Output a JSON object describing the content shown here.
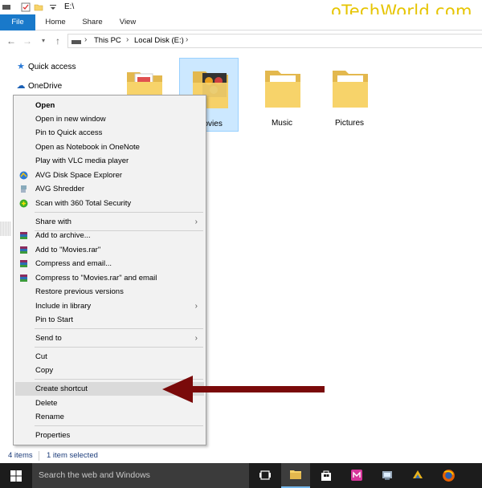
{
  "titlebar": {
    "path": "E:\\",
    "watermark": "oTechWorld.com"
  },
  "ribbon": {
    "tabs": [
      "File",
      "Home",
      "Share",
      "View"
    ]
  },
  "address": {
    "crumbs": [
      "This PC",
      "Local Disk (E:)"
    ]
  },
  "navpane": {
    "items": [
      {
        "label": "Quick access",
        "icon": "star-icon"
      },
      {
        "label": "OneDrive",
        "icon": "cloud-icon"
      }
    ]
  },
  "folders": [
    {
      "label": "",
      "icon": "document-folder-icon",
      "selected": false
    },
    {
      "label": "Movies",
      "icon": "movie-folder-icon",
      "selected": true
    },
    {
      "label": "Music",
      "icon": "folder-icon",
      "selected": false
    },
    {
      "label": "Pictures",
      "icon": "folder-icon",
      "selected": false
    }
  ],
  "context_menu": {
    "items": [
      {
        "label": "Open",
        "bold": true
      },
      {
        "label": "Open in new window"
      },
      {
        "label": "Pin to Quick access"
      },
      {
        "label": "Open as Notebook in OneNote"
      },
      {
        "label": "Play with VLC media player"
      },
      {
        "label": "AVG Disk Space Explorer",
        "icon": "avg-icon"
      },
      {
        "label": "AVG Shredder",
        "icon": "shredder-icon"
      },
      {
        "label": "Scan with 360 Total Security",
        "icon": "security-360-icon"
      },
      {
        "label": "Share with",
        "submenu": true
      },
      {
        "label": "Add to archive...",
        "icon": "winrar-icon"
      },
      {
        "label": "Add to \"Movies.rar\"",
        "icon": "winrar-icon"
      },
      {
        "label": "Compress and email...",
        "icon": "winrar-icon"
      },
      {
        "label": "Compress to \"Movies.rar\" and email",
        "icon": "winrar-icon"
      },
      {
        "label": "Restore previous versions"
      },
      {
        "label": "Include in library",
        "submenu": true
      },
      {
        "label": "Pin to Start"
      },
      {
        "label": "Send to",
        "submenu": true
      },
      {
        "label": "Cut"
      },
      {
        "label": "Copy"
      },
      {
        "label": "Create shortcut",
        "highlighted": true
      },
      {
        "label": "Delete"
      },
      {
        "label": "Rename"
      },
      {
        "label": "Properties"
      }
    ]
  },
  "status": {
    "items_count": "4 items",
    "selected": "1 item selected"
  },
  "taskbar": {
    "search_placeholder": "Search the web and Windows"
  },
  "colors": {
    "accent": "#1979ca",
    "arrow": "#7a0a0a",
    "watermark": "#e6c400",
    "folder": "#f7d36a"
  }
}
